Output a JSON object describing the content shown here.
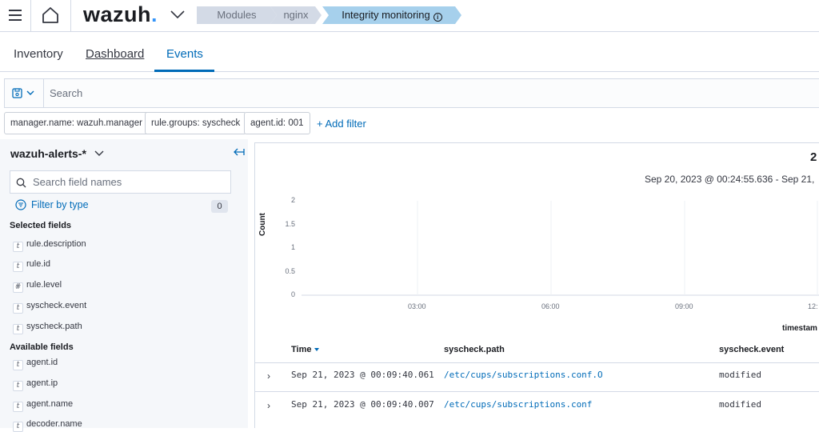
{
  "header": {
    "logo_text": "wazuh",
    "logo_dot": ".",
    "breadcrumbs": [
      "Modules",
      "nginx",
      "Integrity monitoring"
    ],
    "info_glyph": "i"
  },
  "tabs": [
    {
      "label": "Inventory"
    },
    {
      "label": "Dashboard"
    },
    {
      "label": "Events"
    }
  ],
  "search": {
    "placeholder": "Search"
  },
  "filters": [
    "manager.name: wazuh.manager",
    "rule.groups: syscheck",
    "agent.id: 001"
  ],
  "add_filter_label": "+ Add filter",
  "sidebar": {
    "index_pattern": "wazuh-alerts-*",
    "field_search_placeholder": "Search field names",
    "filter_by_type": "Filter by type",
    "filter_count": "0",
    "selected_title": "Selected fields",
    "selected_fields": [
      {
        "type": "t",
        "name": "rule.description"
      },
      {
        "type": "t",
        "name": "rule.id"
      },
      {
        "type": "#",
        "name": "rule.level"
      },
      {
        "type": "t",
        "name": "syscheck.event"
      },
      {
        "type": "t",
        "name": "syscheck.path"
      }
    ],
    "available_title": "Available fields",
    "available_fields": [
      {
        "type": "t",
        "name": "agent.id"
      },
      {
        "type": "t",
        "name": "agent.ip"
      },
      {
        "type": "t",
        "name": "agent.name"
      },
      {
        "type": "t",
        "name": "decoder.name"
      }
    ]
  },
  "main": {
    "hits": "2",
    "time_range": "Sep 20, 2023 @ 00:24:55.636 - Sep 21,"
  },
  "chart_data": {
    "type": "bar",
    "title": "",
    "ylabel": "Count",
    "xlabel": "timestam",
    "ylim": [
      0,
      2
    ],
    "y_ticks": [
      "0",
      "0.5",
      "1",
      "1.5",
      "2"
    ],
    "x_ticks": [
      "03:00",
      "06:00",
      "09:00",
      "12:"
    ],
    "values": [],
    "grid": true
  },
  "table": {
    "columns": [
      "Time",
      "syscheck.path",
      "syscheck.event"
    ],
    "rows": [
      {
        "time": "Sep 21, 2023 @ 00:09:40.061",
        "path": "/etc/cups/subscriptions.conf.O",
        "event": "modified"
      },
      {
        "time": "Sep 21, 2023 @ 00:09:40.007",
        "path": "/etc/cups/subscriptions.conf",
        "event": "modified"
      }
    ],
    "expand_glyph": "›"
  },
  "colors": {
    "accent": "#006bb8",
    "breadcrumb_active": "#a6d0ec",
    "breadcrumb": "#d3dae6",
    "sidebar_bg": "#f5f7fa"
  }
}
